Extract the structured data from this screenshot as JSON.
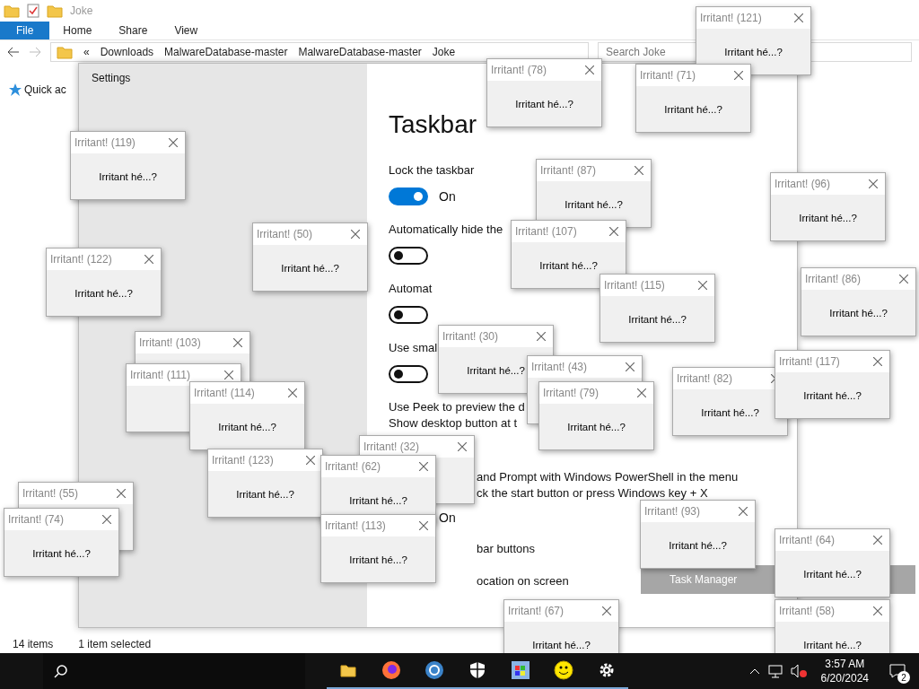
{
  "explorer": {
    "title": "Joke",
    "ribbon_tabs": [
      {
        "label": "File",
        "selected": true
      },
      {
        "label": "Home",
        "selected": false
      },
      {
        "label": "Share",
        "selected": false
      },
      {
        "label": "View",
        "selected": false
      }
    ],
    "breadcrumbs": [
      "«",
      "Downloads",
      "MalwareDatabase-master",
      "MalwareDatabase-master",
      "Joke"
    ],
    "search": {
      "placeholder": "Search Joke"
    },
    "nav_items": [
      "Quick ac"
    ],
    "status": [
      "14 items",
      "1 item selected"
    ]
  },
  "settings": {
    "title": "Settings",
    "heading": "Taskbar",
    "items": [
      {
        "kind": "toggle",
        "lines": [
          "Lock the taskbar"
        ],
        "on": true,
        "state": "On"
      },
      {
        "kind": "toggle",
        "lines": [
          "Automatically hide the"
        ],
        "on": false
      },
      {
        "kind": "toggle",
        "lines": [
          "Automat"
        ],
        "on": false
      },
      {
        "kind": "toggle",
        "lines": [
          "Use smal"
        ],
        "on": false
      },
      {
        "kind": "text",
        "lines": [
          "Use Peek to preview the d",
          "Show desktop button at t"
        ]
      },
      {
        "kind": "partial",
        "lines": [
          "and Prompt with Windows PowerShell in the menu",
          "ck the start button or press Windows key + X"
        ],
        "state": "On"
      },
      {
        "kind": "partial",
        "lines": [
          "bar buttons"
        ]
      },
      {
        "kind": "partial",
        "lines": [
          "ocation on screen"
        ]
      }
    ]
  },
  "dialogs": [
    {
      "title": "Irritant! (121)",
      "message": "Irritant hé...?"
    },
    {
      "title": "Irritant! (78)",
      "message": "Irritant hé...?"
    },
    {
      "title": "Irritant! (71)",
      "message": "Irritant hé...?"
    },
    {
      "title": "Irritant! (119)",
      "message": "Irritant hé...?"
    },
    {
      "title": "Irritant! (87)",
      "message": "Irritant hé...?"
    },
    {
      "title": "Irritant! (96)",
      "message": "Irritant hé...?"
    },
    {
      "title": "Irritant! (50)",
      "message": "Irritant hé...?"
    },
    {
      "title": "Irritant! (107)",
      "message": "Irritant hé...?"
    },
    {
      "title": "Irritant! (122)",
      "message": "Irritant hé...?"
    },
    {
      "title": "Irritant! (115)",
      "message": "Irritant hé...?"
    },
    {
      "title": "Irritant! (86)",
      "message": "Irritant hé...?"
    },
    {
      "title": "Irritant! (30)",
      "message": "Irritant hé...?"
    },
    {
      "title": "Irritant! (103)"
    },
    {
      "title": "Irritant! (111)"
    },
    {
      "title": "Irritant! (114)",
      "message": "Irritant hé...?"
    },
    {
      "title": "Irritant! (43)"
    },
    {
      "title": "Irritant! (79)",
      "message": "Irritant hé...?"
    },
    {
      "title": "Irritant! (82)",
      "message": "Irritant hé...?"
    },
    {
      "title": "Irritant! (117)",
      "message": "Irritant hé...?"
    },
    {
      "title": "Irritant! (32)"
    },
    {
      "title": "Irritant! (123)",
      "message": "Irritant hé...?"
    },
    {
      "title": "Irritant! (62)",
      "message": "Irritant hé...?"
    },
    {
      "title": "Irritant! (113)",
      "message": "Irritant hé...?"
    },
    {
      "title": "Irritant! (55)"
    },
    {
      "title": "Irritant! (74)",
      "message": "Irritant hé...?"
    },
    {
      "title": "Irritant! (93)",
      "message": "Irritant hé...?"
    },
    {
      "title": "Irritant! (64)",
      "message": "Irritant hé...?"
    },
    {
      "title": "Irritant! (67)",
      "message": "Irritant hé...?"
    },
    {
      "title": "Irritant! (58)",
      "message": "Irritant hé...?"
    }
  ],
  "jump_list": {
    "item": "Task Manager"
  },
  "taskbar": {
    "time": "3:57 AM",
    "date": "6/20/2024",
    "notifications": "2"
  }
}
